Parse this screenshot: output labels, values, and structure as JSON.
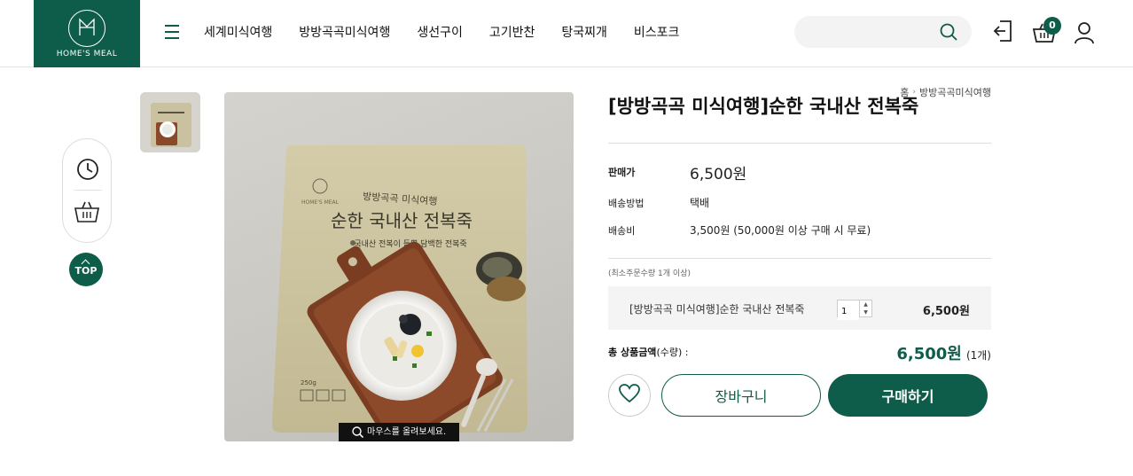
{
  "header": {
    "logo_text": "HOME'S MEAL",
    "nav": [
      "세계미식여행",
      "방방곡곡미식여행",
      "생선구이",
      "고기반찬",
      "탕국찌개",
      "비스포크"
    ],
    "search": {
      "placeholder": "",
      "value": ""
    },
    "cart_count": "0"
  },
  "side": {
    "top_label": "TOP"
  },
  "gallery": {
    "zoom_hint": "마우스를 올려보세요.",
    "package": {
      "brand": "HOME'S MEAL",
      "series": "방방곡곡 미식여행",
      "name": "순한 국내산 전복죽",
      "tagline": "국내산 전복이 듬뿍 담백한 전복죽",
      "weight": "250g"
    }
  },
  "breadcrumb": {
    "home": "홈",
    "category": "방방곡곡미식여행"
  },
  "product": {
    "title": "[방방곡곡 미식여행]순한 국내산 전복죽",
    "price_label": "판매가",
    "price": "6,500원",
    "shipping_method_label": "배송방법",
    "shipping_method": "택배",
    "shipping_fee_label": "배송비",
    "shipping_fee": "3,500원 (50,000원 이상 구매 시 무료)",
    "min_qty": "(최소주문수량 1개 이상)"
  },
  "option": {
    "name": "[방방곡곡 미식여행]순한 국내산 전복죽",
    "qty": "1",
    "price": "6,500원"
  },
  "total": {
    "label": "총 상품금액",
    "sub": "(수량) :",
    "price": "6,500원",
    "count": "(1개)"
  },
  "buttons": {
    "cart": "장바구니",
    "buy": "구매하기"
  },
  "colors": {
    "brand": "#0e5c4a"
  }
}
